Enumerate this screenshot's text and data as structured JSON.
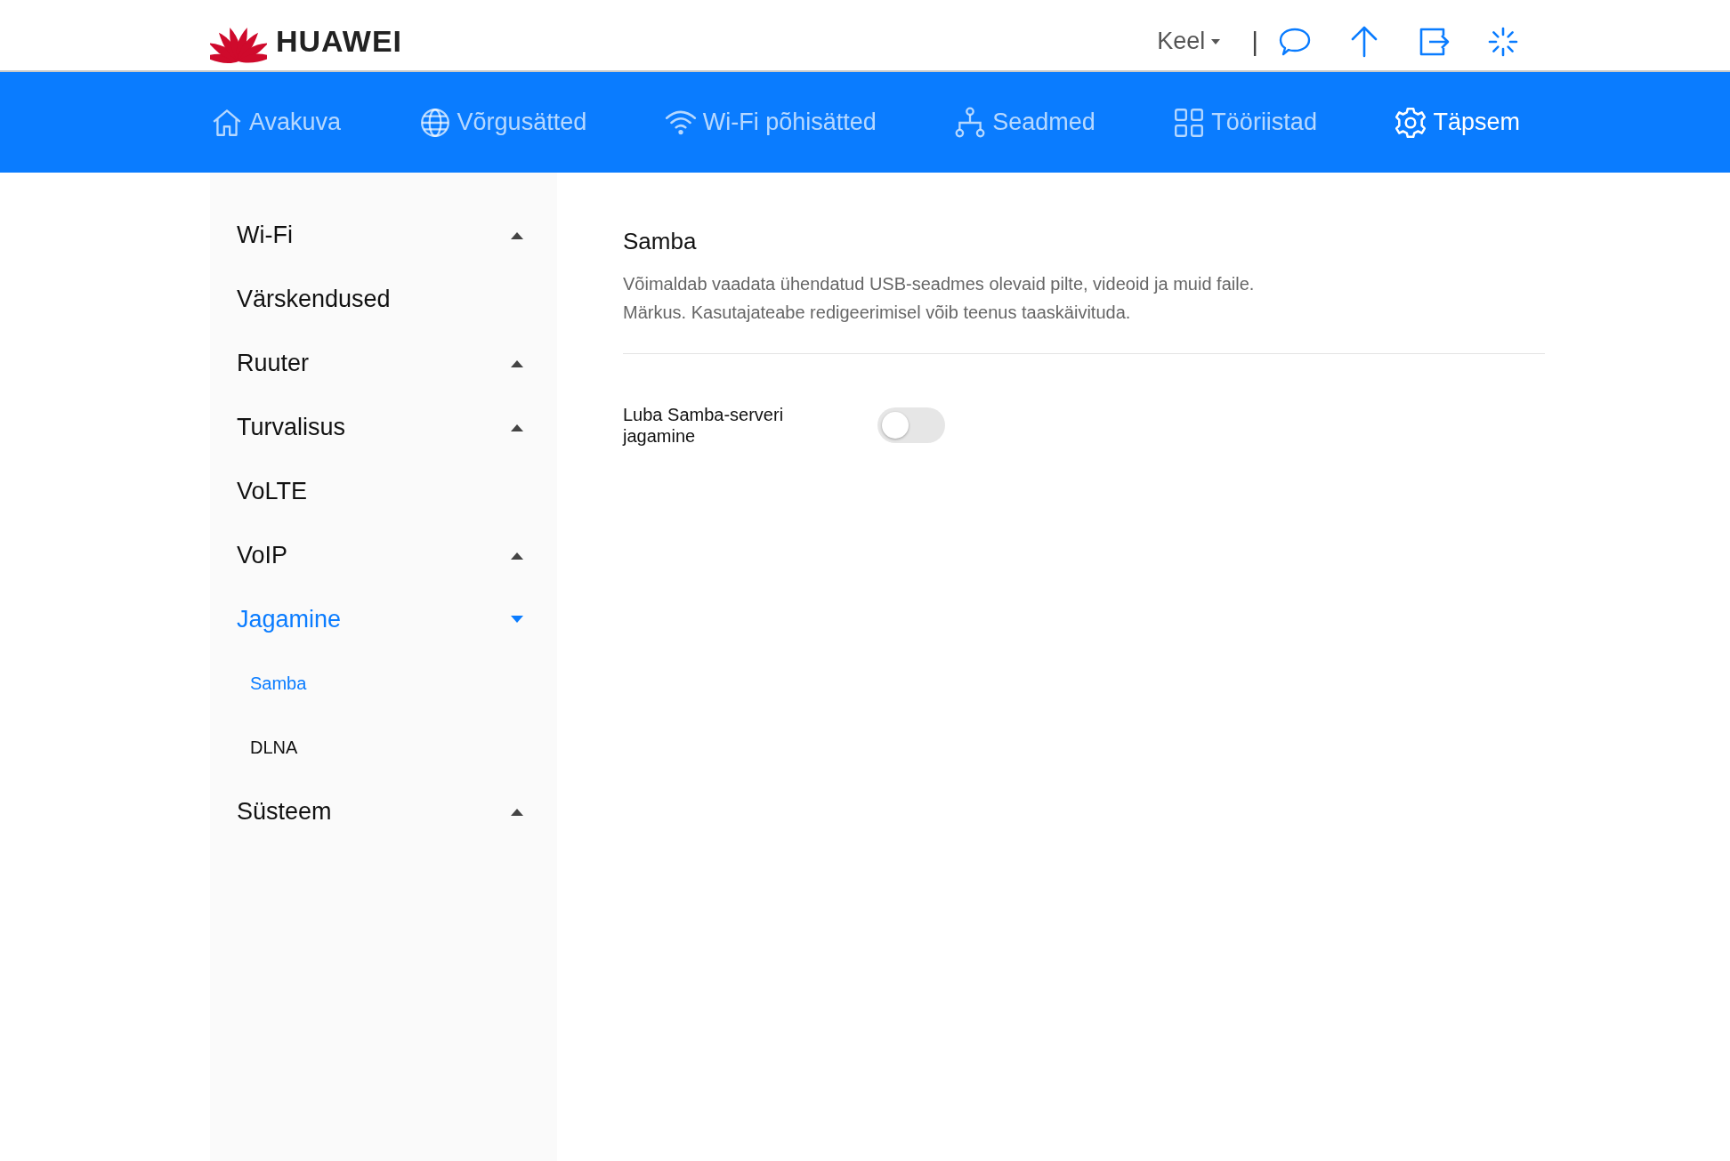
{
  "header": {
    "brand": "HUAWEI",
    "language": "Keel",
    "separator": "|"
  },
  "nav": [
    {
      "label": "Avakuva",
      "kind": "home",
      "selected": false
    },
    {
      "label": "Võrgusätted",
      "kind": "globe",
      "selected": false
    },
    {
      "label": "Wi-Fi põhisätted",
      "kind": "wifi",
      "selected": false
    },
    {
      "label": "Seadmed",
      "kind": "devices",
      "selected": false
    },
    {
      "label": "Tööriistad",
      "kind": "tools",
      "selected": false
    },
    {
      "label": "Täpsem",
      "kind": "gear",
      "selected": true
    }
  ],
  "sidebar": {
    "items": [
      {
        "label": "Wi-Fi",
        "kind": "group",
        "expanded": false,
        "selected": false
      },
      {
        "label": "Värskendused",
        "kind": "link",
        "selected": false
      },
      {
        "label": "Ruuter",
        "kind": "group",
        "expanded": false,
        "selected": false
      },
      {
        "label": "Turvalisus",
        "kind": "group",
        "expanded": false,
        "selected": false
      },
      {
        "label": "VoLTE",
        "kind": "link",
        "selected": false
      },
      {
        "label": "VoIP",
        "kind": "group",
        "expanded": false,
        "selected": false
      },
      {
        "label": "Jagamine",
        "kind": "group",
        "expanded": true,
        "selected": true,
        "children": [
          {
            "label": "Samba",
            "selected": true
          },
          {
            "label": "DLNA",
            "selected": false
          }
        ]
      },
      {
        "label": "Süsteem",
        "kind": "group",
        "expanded": false,
        "selected": false
      }
    ]
  },
  "content": {
    "title": "Samba",
    "description": [
      "Võimaldab vaadata ühendatud USB-seadmes olevaid pilte, videoid ja muid faile.",
      "Märkus. Kasutajateabe redigeerimisel võib teenus taaskäivituda."
    ],
    "settings": [
      {
        "label": "Luba Samba-serveri jagamine",
        "on": false
      }
    ]
  }
}
